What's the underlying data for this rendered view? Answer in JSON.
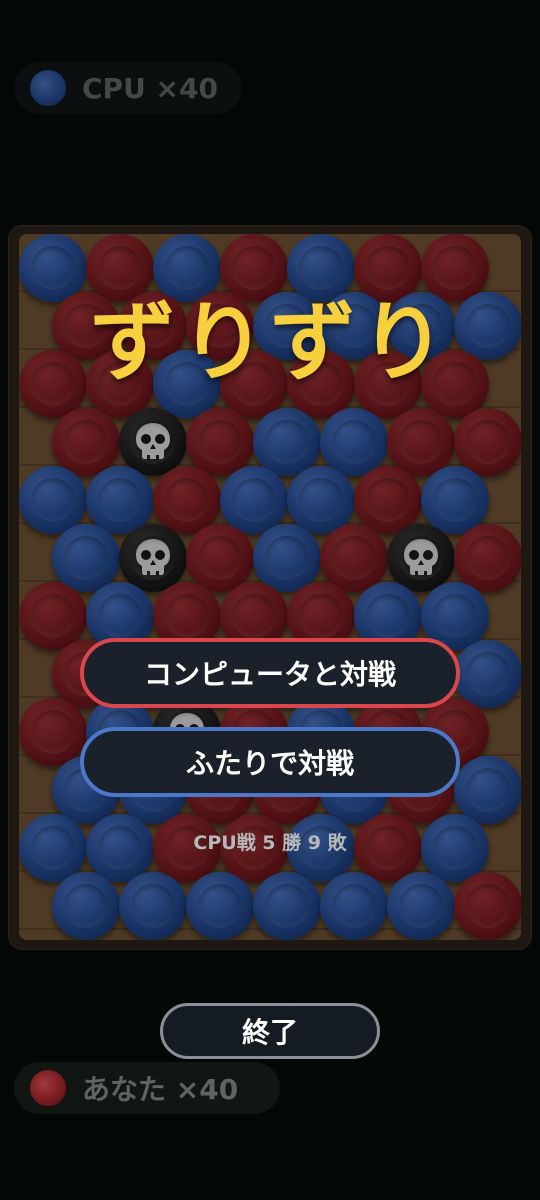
{
  "players": {
    "cpu": {
      "label": "CPU ×40",
      "color": "blue"
    },
    "you": {
      "label": "あなた ×40",
      "color": "red"
    }
  },
  "menu": {
    "title": "ずりずり",
    "vs_cpu_label": "コンピュータと対戦",
    "vs_two_label": "ふたりで対戦",
    "record_text": "CPU戦 5 勝 9 敗",
    "exit_label": "終了"
  },
  "colors": {
    "title": "#f8cf3c",
    "cpu_button_border": "#d9464b",
    "two_player_button_border": "#4c78cc",
    "blue_piece": "#23478d",
    "red_piece": "#761a1f"
  },
  "board": {
    "rows": [
      [
        "B",
        "R",
        "B",
        "R",
        "B",
        "R",
        "R"
      ],
      [
        "R",
        "R",
        "R",
        "B",
        "B",
        "B",
        "B"
      ],
      [
        "R",
        "R",
        "B",
        "R",
        "R",
        "R",
        "R"
      ],
      [
        "R",
        "S",
        "R",
        "B",
        "B",
        "R",
        "R"
      ],
      [
        "B",
        "B",
        "R",
        "B",
        "B",
        "R",
        "B"
      ],
      [
        "B",
        "S",
        "R",
        "B",
        "R",
        "S",
        "R"
      ],
      [
        "R",
        "B",
        "R",
        "R",
        "R",
        "B",
        "B"
      ],
      [
        "R",
        "R",
        "B",
        "R",
        "B",
        "R",
        "B"
      ],
      [
        "R",
        "B",
        "S",
        "R",
        "B",
        "R",
        "R"
      ],
      [
        "B",
        "B",
        "R",
        "R",
        "B",
        "R",
        "B"
      ],
      [
        "B",
        "B",
        "R",
        "R",
        "B",
        "R",
        "B"
      ],
      [
        "B",
        "B",
        "B",
        "B",
        "B",
        "B",
        "R"
      ]
    ]
  }
}
